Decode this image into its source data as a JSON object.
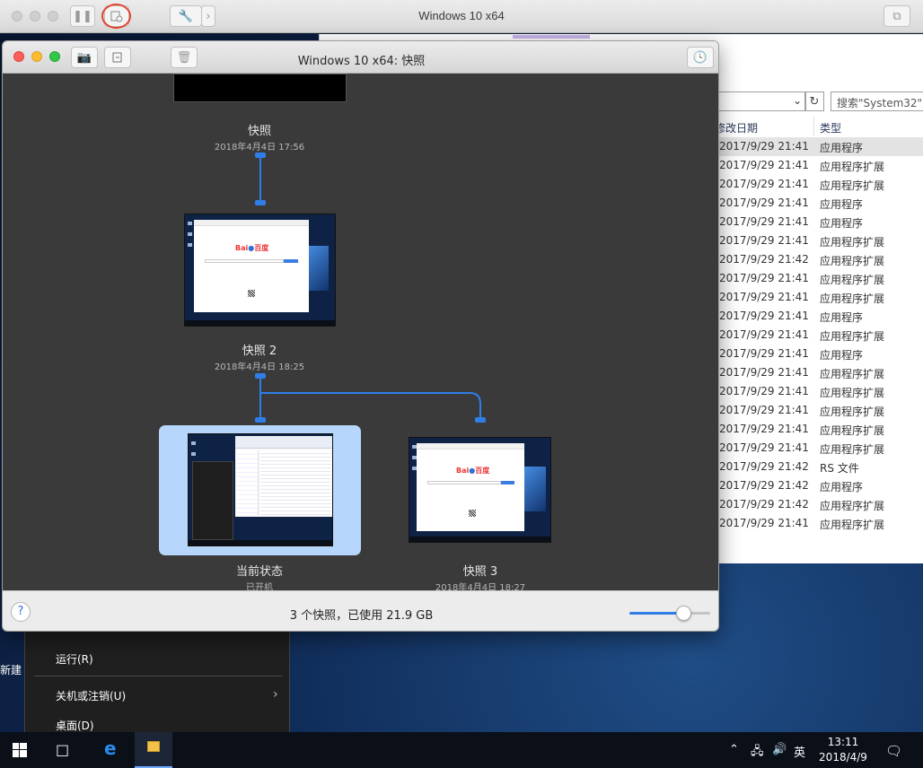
{
  "host": {
    "title": "Windows 10 x64"
  },
  "snapshot_window": {
    "title": "Windows 10 x64: 快照",
    "footer_status": "3 个快照，已使用 21.9 GB",
    "help_label": "?",
    "zoom_level": 0.67,
    "snapshots": [
      {
        "name": "快照",
        "date": "2018年4月4日 17:56"
      },
      {
        "name": "快照 2",
        "date": "2018年4月4日 18:25"
      },
      {
        "name": "当前状态",
        "date": "已开机"
      },
      {
        "name": "快照 3",
        "date": "2018年4月4日 18:27"
      }
    ]
  },
  "explorer": {
    "search_placeholder": "搜索\"System32\"",
    "columns": {
      "modified": "修改日期",
      "type": "类型"
    },
    "rows": [
      {
        "date": "2017/9/29 21:41",
        "type": "应用程序"
      },
      {
        "date": "2017/9/29 21:41",
        "type": "应用程序扩展"
      },
      {
        "date": "2017/9/29 21:41",
        "type": "应用程序扩展"
      },
      {
        "date": "2017/9/29 21:41",
        "type": "应用程序"
      },
      {
        "date": "2017/9/29 21:41",
        "type": "应用程序"
      },
      {
        "date": "2017/9/29 21:41",
        "type": "应用程序扩展"
      },
      {
        "date": "2017/9/29 21:42",
        "type": "应用程序扩展"
      },
      {
        "date": "2017/9/29 21:41",
        "type": "应用程序扩展"
      },
      {
        "date": "2017/9/29 21:41",
        "type": "应用程序扩展"
      },
      {
        "date": "2017/9/29 21:41",
        "type": "应用程序"
      },
      {
        "date": "2017/9/29 21:41",
        "type": "应用程序扩展"
      },
      {
        "date": "2017/9/29 21:41",
        "type": "应用程序"
      },
      {
        "date": "2017/9/29 21:41",
        "type": "应用程序扩展"
      },
      {
        "date": "2017/9/29 21:41",
        "type": "应用程序扩展"
      },
      {
        "date": "2017/9/29 21:41",
        "type": "应用程序扩展"
      },
      {
        "date": "2017/9/29 21:41",
        "type": "应用程序扩展"
      },
      {
        "date": "2017/9/29 21:41",
        "type": "应用程序扩展"
      },
      {
        "date": "2017/9/29 21:42",
        "type": "RS 文件"
      },
      {
        "date": "2017/9/29 21:42",
        "type": "应用程序"
      },
      {
        "date": "2017/9/29 21:42",
        "type": "应用程序扩展"
      },
      {
        "date": "2017/9/29 21:41",
        "type": "应用程序扩展"
      }
    ]
  },
  "start_menu": {
    "run": "运行(R)",
    "shutdown": "关机或注销(U)",
    "desktop": "桌面(D)"
  },
  "desktop_icon_label": "新建",
  "taskbar": {
    "ime": "英",
    "time": "13:11",
    "date": "2018/4/9"
  },
  "colors": {
    "accent": "#2f7ee8",
    "selection": "#b7d6fb",
    "annotation": "#e0442e"
  }
}
